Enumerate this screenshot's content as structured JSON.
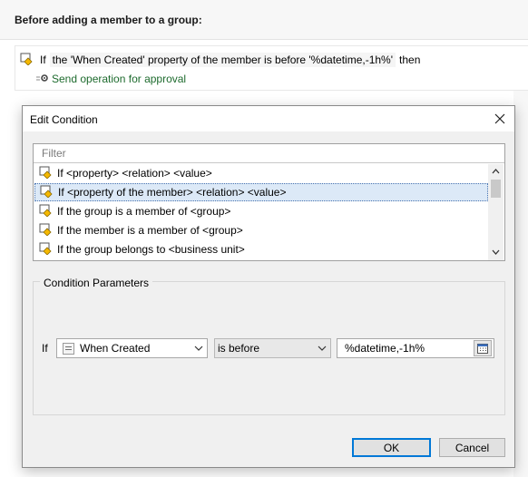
{
  "background": {
    "heading": "Before adding a member to a group:",
    "rule": {
      "if_keyword": "If",
      "condition": "the 'When Created' property of the member is before '%datetime,-1h%'",
      "then_keyword": "then",
      "action": "Send operation for approval"
    }
  },
  "dialog": {
    "title": "Edit Condition",
    "filter_placeholder": "Filter",
    "conditions": [
      {
        "label": "If <property> <relation> <value>",
        "selected": false
      },
      {
        "label": "If <property of the member> <relation> <value>",
        "selected": true
      },
      {
        "label": "If the group is a member of <group>",
        "selected": false
      },
      {
        "label": "If the member is a member of <group>",
        "selected": false
      },
      {
        "label": "If the group belongs to <business unit>",
        "selected": false
      }
    ],
    "parameters": {
      "group_label": "Condition Parameters",
      "if_label": "If",
      "property": "When Created",
      "relation": "is before",
      "value": "%datetime,-1h%"
    },
    "buttons": {
      "ok": "OK",
      "cancel": "Cancel"
    }
  },
  "colors": {
    "selection_bg": "#dce9f7",
    "action_text": "#1e6b2e",
    "default_button_border": "#0078d7"
  }
}
